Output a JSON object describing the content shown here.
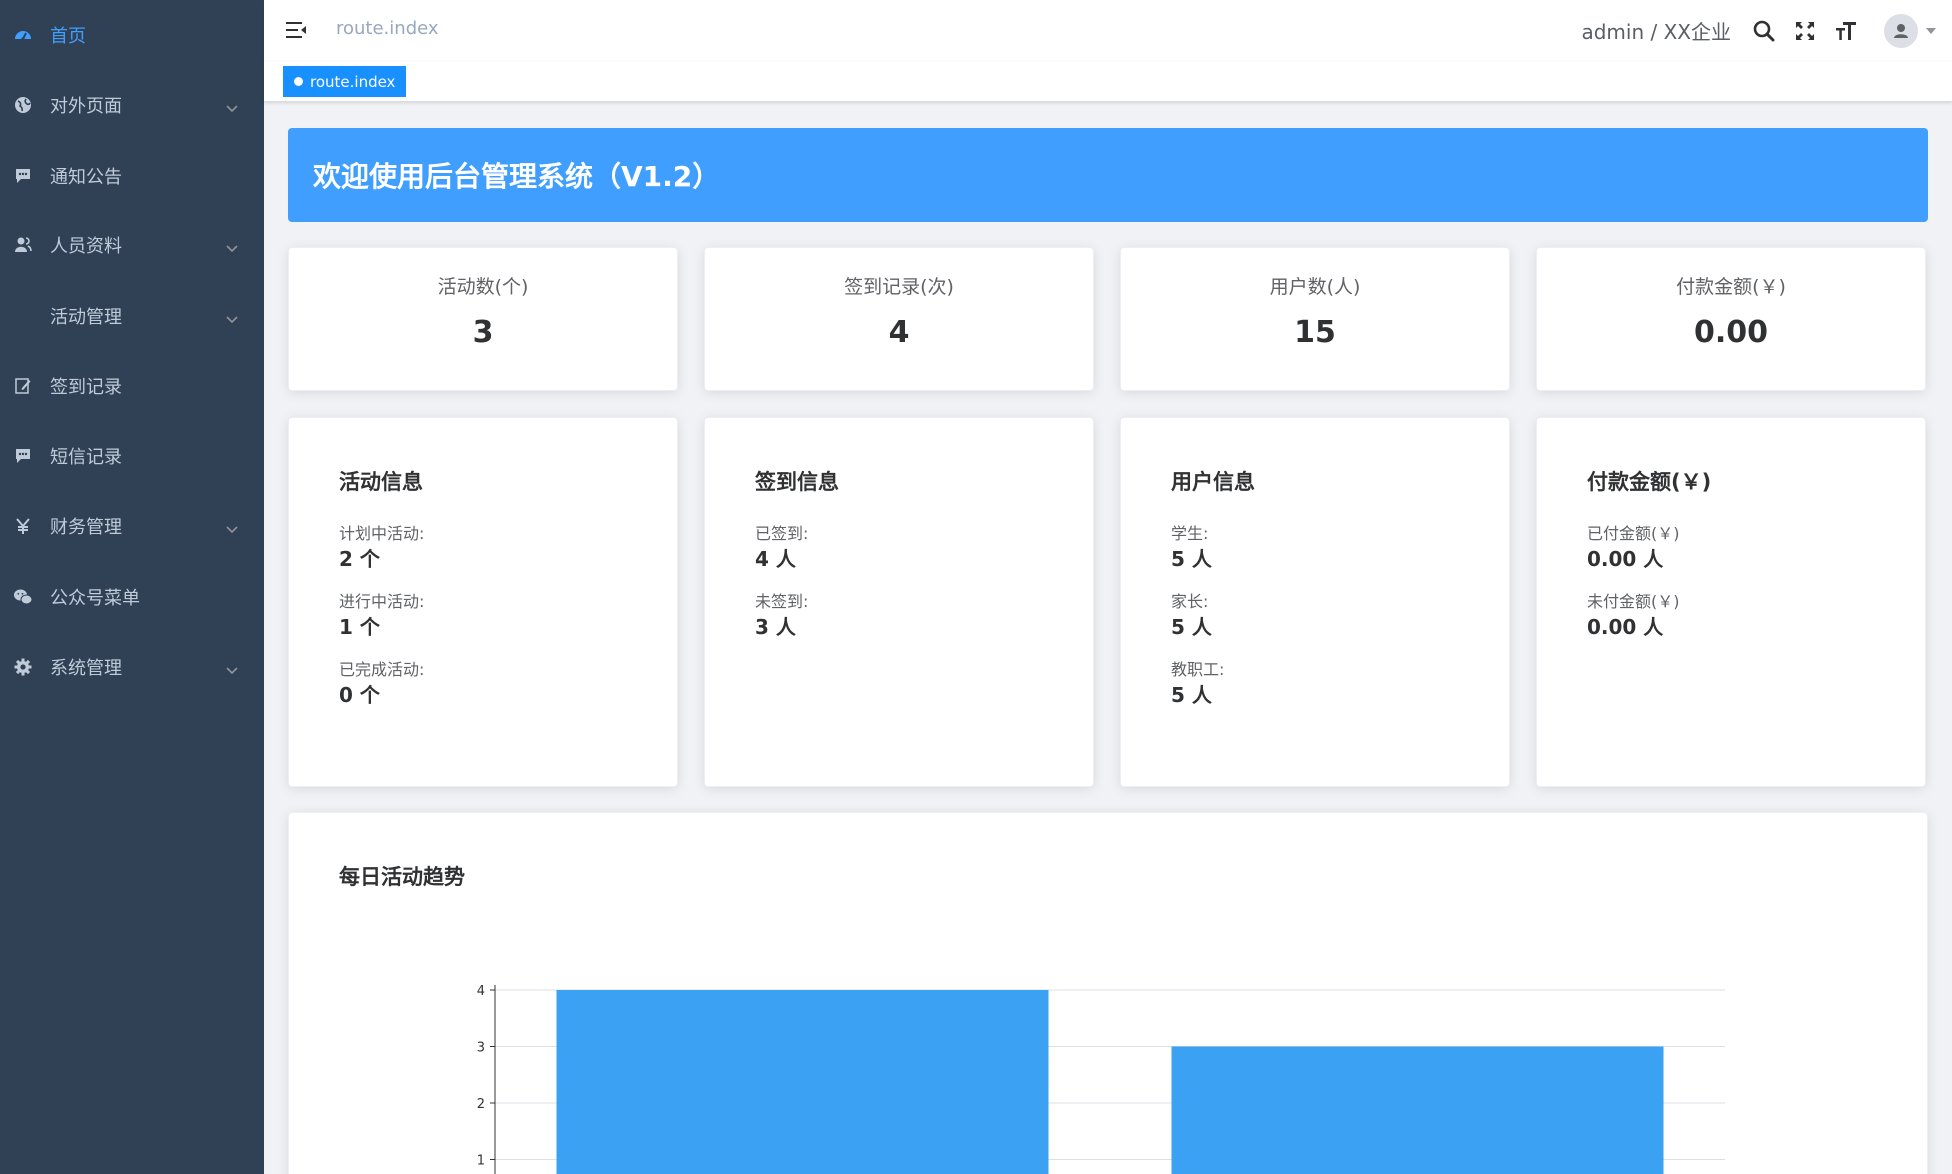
{
  "sidebar": {
    "items": [
      {
        "label": "首页",
        "icon": "dashboard-icon",
        "active": true,
        "has_children": false
      },
      {
        "label": "对外页面",
        "icon": "globe-icon",
        "active": false,
        "has_children": true
      },
      {
        "label": "通知公告",
        "icon": "message-icon",
        "active": false,
        "has_children": false
      },
      {
        "label": "人员资料",
        "icon": "peoples-icon",
        "active": false,
        "has_children": true
      },
      {
        "label": "活动管理",
        "icon": "",
        "active": false,
        "has_children": true
      },
      {
        "label": "签到记录",
        "icon": "edit-icon",
        "active": false,
        "has_children": false
      },
      {
        "label": "短信记录",
        "icon": "message-icon",
        "active": false,
        "has_children": false
      },
      {
        "label": "财务管理",
        "icon": "yen-icon",
        "active": false,
        "has_children": true
      },
      {
        "label": "公众号菜单",
        "icon": "wechat-icon",
        "active": false,
        "has_children": false
      },
      {
        "label": "系统管理",
        "icon": "gear-icon",
        "active": false,
        "has_children": true
      }
    ]
  },
  "header": {
    "breadcrumb": "route.index",
    "user": "admin / XX企业"
  },
  "tags": {
    "active_tag": "route.index"
  },
  "banner": {
    "title": "欢迎使用后台管理系统（V1.2）"
  },
  "stats": [
    {
      "title": "活动数(个)",
      "value": "3"
    },
    {
      "title": "签到记录(次)",
      "value": "4"
    },
    {
      "title": "用户数(人)",
      "value": "15"
    },
    {
      "title": "付款金额(￥)",
      "value": "0.00"
    }
  ],
  "info_cards": [
    {
      "title": "活动信息",
      "rows": [
        {
          "label": "计划中活动:",
          "value": "2 个"
        },
        {
          "label": "进行中活动:",
          "value": "1 个"
        },
        {
          "label": "已完成活动:",
          "value": "0 个"
        }
      ]
    },
    {
      "title": "签到信息",
      "rows": [
        {
          "label": "已签到:",
          "value": "4 人"
        },
        {
          "label": "未签到:",
          "value": "3 人"
        }
      ]
    },
    {
      "title": "用户信息",
      "rows": [
        {
          "label": "学生:",
          "value": "5 人"
        },
        {
          "label": "家长:",
          "value": "5 人"
        },
        {
          "label": "教职工:",
          "value": "5 人"
        }
      ]
    },
    {
      "title": "付款金额(￥)",
      "rows": [
        {
          "label": "已付金额(￥)",
          "value": "0.00 人"
        },
        {
          "label": "未付金额(￥)",
          "value": "0.00 人"
        }
      ]
    }
  ],
  "chart_data": {
    "type": "bar",
    "title": "每日活动趋势",
    "categories": [
      "",
      ""
    ],
    "values": [
      4,
      3
    ],
    "yticks": [
      1,
      2,
      3,
      4
    ],
    "ylim": [
      0,
      4
    ],
    "bar_color": "#3ba1f3",
    "grid": true
  },
  "colors": {
    "sidebar_bg": "#304156",
    "accent": "#409eff",
    "tag_bg": "#1890ff"
  }
}
